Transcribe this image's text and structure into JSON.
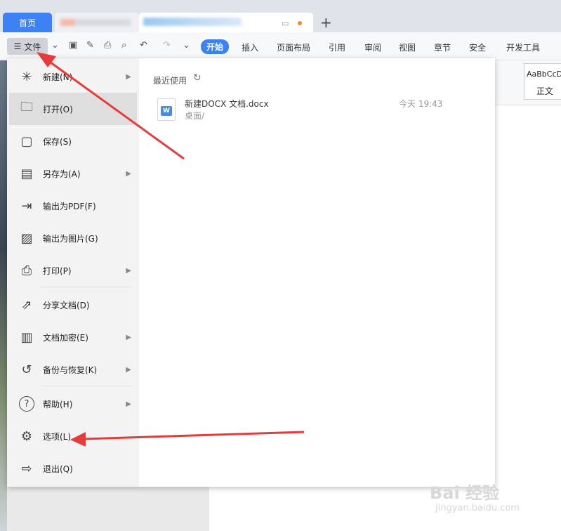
{
  "tabs": {
    "home": "首页"
  },
  "toolbar": {
    "file_label": "文件",
    "ribbon_tabs": [
      "开始",
      "插入",
      "页面布局",
      "引用",
      "审阅",
      "视图",
      "章节",
      "安全",
      "开发工具"
    ],
    "active_tab": "开始"
  },
  "style_gallery": {
    "sample": "AaBbCcD",
    "name": "正文"
  },
  "menu": {
    "items": [
      {
        "label": "新建(N)",
        "icon": "new-icon",
        "submenu": true
      },
      {
        "label": "打开(O)",
        "icon": "open-folder-icon",
        "submenu": false
      },
      {
        "label": "保存(S)",
        "icon": "save-icon",
        "submenu": false
      },
      {
        "label": "另存为(A)",
        "icon": "save-as-icon",
        "submenu": true
      },
      {
        "label": "输出为PDF(F)",
        "icon": "export-pdf-icon",
        "submenu": false
      },
      {
        "label": "输出为图片(G)",
        "icon": "export-image-icon",
        "submenu": false
      },
      {
        "label": "打印(P)",
        "icon": "print-icon",
        "submenu": true
      },
      {
        "label": "分享文档(D)",
        "icon": "share-icon",
        "submenu": false
      },
      {
        "label": "文档加密(E)",
        "icon": "encrypt-icon",
        "submenu": true
      },
      {
        "label": "备份与恢复(K)",
        "icon": "backup-icon",
        "submenu": true
      },
      {
        "label": "帮助(H)",
        "icon": "help-icon",
        "submenu": true
      },
      {
        "label": "选项(L)",
        "icon": "gear-icon",
        "submenu": false
      },
      {
        "label": "退出(Q)",
        "icon": "exit-icon",
        "submenu": false
      }
    ],
    "active_item": "打开(O)"
  },
  "recent": {
    "title": "最近使用",
    "files": [
      {
        "name": "新建DOCX 文档.docx",
        "path": "桌面/",
        "time": "今天 19:43",
        "badge": "W"
      }
    ]
  },
  "watermark": {
    "main": "Bai 经验",
    "sub": "jingyan.baidu.com"
  },
  "colors": {
    "accent": "#3b82f6",
    "annotation_arrow": "#e83a3a"
  }
}
